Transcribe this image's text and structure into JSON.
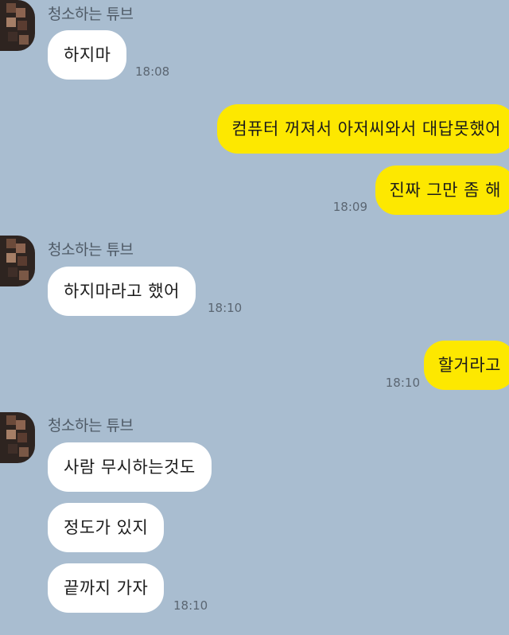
{
  "chat": {
    "sender_name": "청소하는 튜브",
    "groups": [
      {
        "sender": "청소하는 튜브",
        "messages": [
          {
            "text": "하지마",
            "time": "18:08"
          }
        ]
      },
      {
        "sender": "me",
        "messages": [
          {
            "text": "컴퓨터 꺼져서 아저씨와서 대답못했어"
          },
          {
            "text": "진짜 그만 좀 해",
            "time": "18:09"
          }
        ]
      },
      {
        "sender": "청소하는 튜브",
        "messages": [
          {
            "text": "하지마라고 했어",
            "time": "18:10"
          }
        ]
      },
      {
        "sender": "me",
        "messages": [
          {
            "text": "할거라고",
            "time": "18:10"
          }
        ]
      },
      {
        "sender": "청소하는 튜브",
        "messages": [
          {
            "text": "사람 무시하는것도"
          },
          {
            "text": "정도가 있지"
          },
          {
            "text": "끝까지 가자",
            "time": "18:10"
          }
        ]
      }
    ]
  },
  "colors": {
    "background": "#a9bdd0",
    "incoming_bubble": "#ffffff",
    "outgoing_bubble": "#fde800"
  }
}
